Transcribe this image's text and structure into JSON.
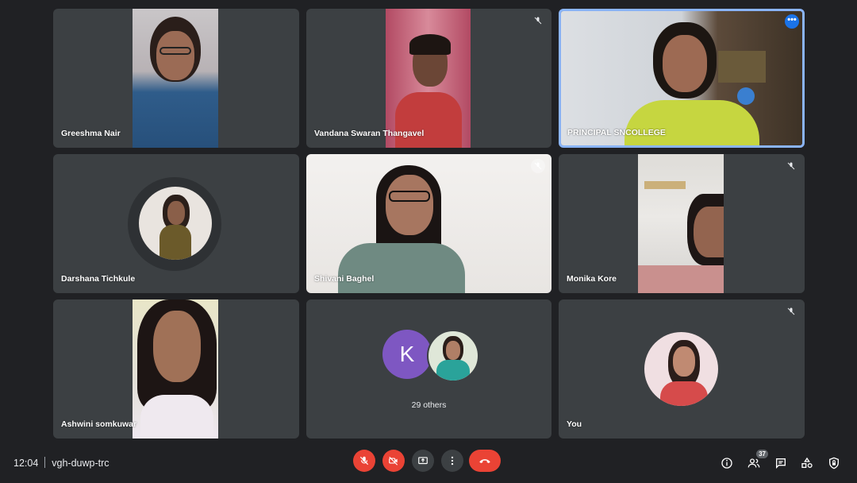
{
  "meeting": {
    "time": "12:04",
    "code": "vgh-duwp-trc"
  },
  "colors": {
    "accent_red": "#ea4335",
    "active_border": "#8ab4f8",
    "tile_bg": "#3c4043",
    "page_bg": "#202124"
  },
  "participants": [
    {
      "name": "Greeshma Nair",
      "video": true,
      "muted": false
    },
    {
      "name": "Vandana Swaran Thangavel",
      "video": true,
      "muted": true
    },
    {
      "name": "PRINCIPAL SNCOLLEGE",
      "video": true,
      "speaking": true,
      "more_menu": "•••"
    },
    {
      "name": "Darshana Tichkule",
      "video": false,
      "muted": false
    },
    {
      "name": "Shivani Baghel",
      "video": true,
      "muted": true
    },
    {
      "name": "Monika Kore",
      "video": true,
      "muted": true
    },
    {
      "name": "Ashwini somkuwar",
      "video": true,
      "muted": false
    },
    {
      "others_initial": "K",
      "others_label": "29 others"
    },
    {
      "name": "You",
      "video": false,
      "muted": true
    }
  ],
  "controls": {
    "mic_icon": "mic-off-icon",
    "camera_icon": "camera-off-icon",
    "present_icon": "present-screen-icon",
    "more_icon": "more-options-icon",
    "leave_icon": "end-call-icon"
  },
  "right_controls": {
    "info_icon": "info-icon",
    "people_icon": "people-icon",
    "people_count": "37",
    "chat_icon": "chat-icon",
    "activities_icon": "activities-icon",
    "host_icon": "host-controls-icon"
  }
}
